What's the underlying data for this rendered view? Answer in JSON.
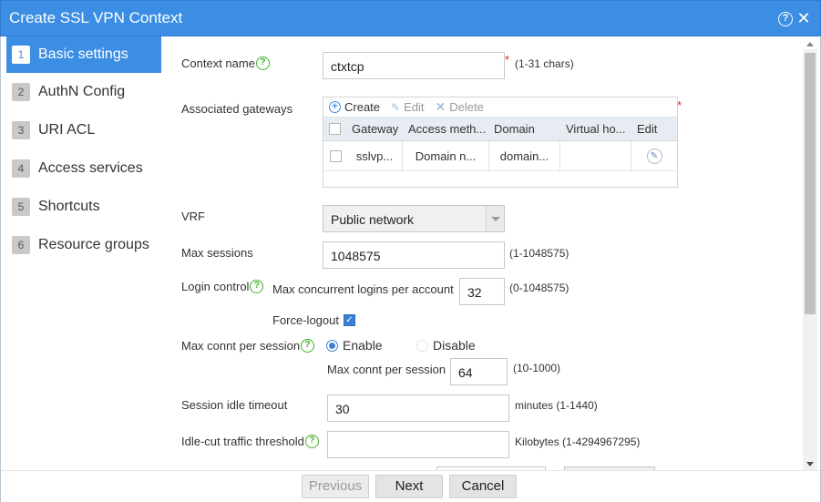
{
  "window": {
    "title": "Create SSL VPN Context"
  },
  "steps": [
    {
      "num": "1",
      "label": "Basic settings"
    },
    {
      "num": "2",
      "label": "AuthN Config"
    },
    {
      "num": "3",
      "label": "URI ACL"
    },
    {
      "num": "4",
      "label": "Access services"
    },
    {
      "num": "5",
      "label": "Shortcuts"
    },
    {
      "num": "6",
      "label": "Resource groups"
    }
  ],
  "form": {
    "context_name": {
      "label": "Context name",
      "value": "ctxtcp",
      "required": "*",
      "hint": "(1-31 chars)"
    },
    "gateways": {
      "label": "Associated gateways",
      "required": "*",
      "toolbar": {
        "create": "Create",
        "edit": "Edit",
        "delete": "Delete"
      },
      "columns": [
        "Gateway",
        "Access meth...",
        "Domain",
        "Virtual ho...",
        "Edit"
      ],
      "rows": [
        {
          "gateway": "sslvp...",
          "access": "Domain n...",
          "domain": "domain...",
          "virtual": ""
        }
      ]
    },
    "vrf": {
      "label": "VRF",
      "value": "Public network"
    },
    "max_sessions": {
      "label": "Max sessions",
      "value": "1048575",
      "hint": "(1-1048575)"
    },
    "login_control": {
      "label": "Login control",
      "sublabel": "Max concurrent logins per account",
      "value": "32",
      "hint": "(0-1048575)",
      "force_logout": "Force-logout"
    },
    "max_connt": {
      "label": "Max connt per session",
      "enable": "Enable",
      "disable": "Disable",
      "sublabel": "Max connt per session",
      "value": "64",
      "hint": "(10-1000)"
    },
    "idle_timeout": {
      "label": "Session idle timeout",
      "value": "30",
      "hint": "minutes (1-1440)"
    },
    "idle_cut": {
      "label": "Idle-cut traffic threshold",
      "value": "",
      "hint": "Kilobytes (1-4294967295)"
    }
  },
  "footer": {
    "previous": "Previous",
    "next": "Next",
    "cancel": "Cancel"
  },
  "colors": {
    "accent": "#3b8ee3",
    "help_green": "#3fae29",
    "required_red": "#e02020"
  }
}
